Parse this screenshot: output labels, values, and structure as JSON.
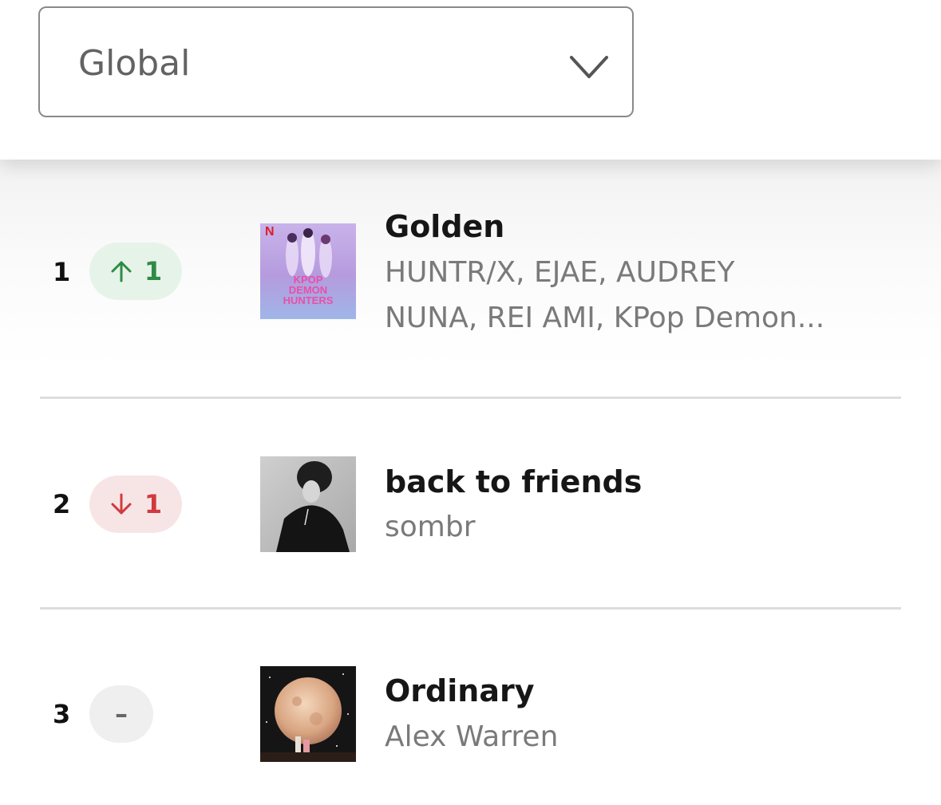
{
  "region_select": {
    "value": "Global"
  },
  "rows": [
    {
      "rank": "1",
      "movement": "up",
      "movement_value": "1",
      "title": "Golden",
      "artists_line1": "HUNTR/X, EJAE, AUDREY",
      "artists_line2": "NUNA, REI AMI, KPop Demon...",
      "cover": "kpop-demon-hunters-cover",
      "cover_text": [
        "KPOP",
        "DEMON",
        "HUNTERS"
      ],
      "cover_logo": "N"
    },
    {
      "rank": "2",
      "movement": "down",
      "movement_value": "1",
      "title": "back to friends",
      "artists_line1": "sombr",
      "cover": "sombr-portrait-cover"
    },
    {
      "rank": "3",
      "movement": "same",
      "movement_value": "–",
      "title": "Ordinary",
      "artists_line1": "Alex Warren",
      "cover": "full-moon-cover"
    }
  ],
  "colors": {
    "up": "#2e8b45",
    "down": "#d03a3e",
    "same": "#666666"
  }
}
